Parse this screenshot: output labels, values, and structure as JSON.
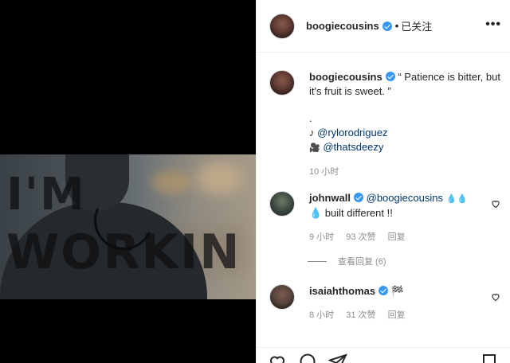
{
  "post": {
    "username": "boogiecousins",
    "follow_status": "已关注",
    "separator": "•",
    "more": "•••"
  },
  "media": {
    "overlay_line1": "I'M",
    "overlay_line2": "WORKIN"
  },
  "caption": {
    "username": "boogiecousins",
    "text": "“ Patience is bitter, but it's fruit is sweet. ”",
    "dot": ".",
    "credit1_icon": "♪",
    "credit1": "@rylorodriguez",
    "credit2_icon": "🎥",
    "credit2": "@thatsdeezy",
    "time": "10 小时"
  },
  "comments": [
    {
      "username": "johnwall",
      "mention": "@boogiecousins",
      "text_after_mention": "💧💧",
      "line2": "💧 built different !!",
      "time": "9 小时",
      "likes": "93 次赞",
      "reply": "回复"
    },
    {
      "username": "isaiahthomas",
      "text": "🏁",
      "time": "8 小时",
      "likes": "31 次赞",
      "reply": "回复"
    }
  ],
  "view_replies": "查看回复 (6)",
  "icons": {
    "heart": "heart-icon",
    "comment": "comment-icon",
    "share": "share-icon",
    "bookmark": "bookmark-icon"
  },
  "colors": {
    "verified": "#3897f0",
    "link": "#00376b",
    "muted": "#8e8e8e"
  }
}
